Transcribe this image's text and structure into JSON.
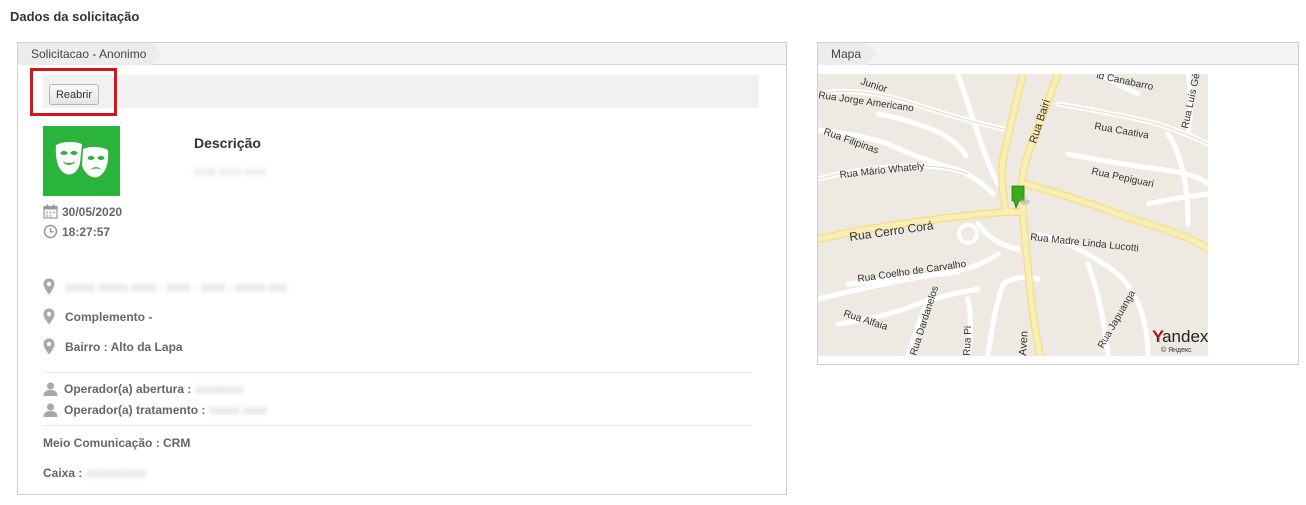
{
  "page": {
    "title": "Dados da solicitação"
  },
  "left_panel": {
    "tab_label": "Solicitacao - Anonimo",
    "reopen_button": "Reabrir",
    "description_title": "Descrição",
    "description_value": "xxxx xxxx xxxx",
    "date": "30/05/2020",
    "time": "18:27:57",
    "address": "xxxxx xxxxx xxxx - xxxx - xxxx - xxxxx xxx",
    "complement": "Complemento -",
    "neighborhood": "Bairro : Alto da Lapa",
    "operator_open_label": "Operador(a) abertura :",
    "operator_open_value": "xxxxxxxx",
    "operator_treat_label": "Operador(a) tratamento :",
    "operator_treat_value": "xxxxx xxxx",
    "channel": "Meio Comunicação : CRM",
    "box_label": "Caixa :",
    "box_value": "xxxxxxxxxx"
  },
  "right_panel": {
    "tab_label": "Mapa",
    "map": {
      "streets": [
        "Junior",
        "Rua Jorge Americano",
        "Rua Filipinas",
        "Rua Mário Whately",
        "Rua Cerro Corá",
        "Rua Coelho de Carvalho",
        "Rua Alfaia",
        "Rua Dardanelos",
        "Rua Pi",
        "Aven",
        "Rua Bairi",
        "Rua Caativa",
        "Rua Pepiguari",
        "Rua Madre Linda Lucotti",
        "Rua Japuanga",
        "id Canabarro",
        "Rua Luís Gé"
      ],
      "brand": "Yandex",
      "brand_sub": "© Яндекс"
    }
  },
  "colors": {
    "highlight": "#d9121b",
    "icon_bg": "#2bb43b",
    "map_bg": "#eeeae3",
    "main_road": "#f7e9a6",
    "marker": "#3aab1c"
  }
}
